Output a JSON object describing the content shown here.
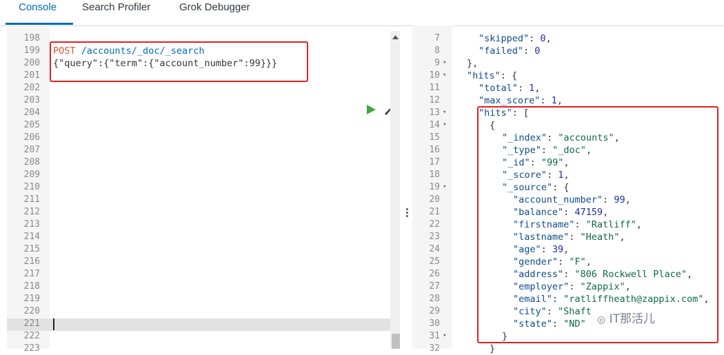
{
  "tabs": [
    "Console",
    "Search Profiler",
    "Grok Debugger"
  ],
  "left": {
    "line_numbers": [
      "198",
      "199",
      "200",
      "201",
      "202",
      "203",
      "204",
      "205",
      "206",
      "207",
      "208",
      "209",
      "210",
      "211",
      "212",
      "213",
      "214",
      "215",
      "216",
      "217",
      "218",
      "219",
      "220",
      "221",
      "222",
      "223"
    ],
    "request_method": "POST",
    "request_path": "/accounts/_doc/_search",
    "request_body": "{\"query\":{\"term\":{\"account_number\":99}}}"
  },
  "right": {
    "line_numbers": [
      "7",
      "8",
      "9",
      "10",
      "11",
      "12",
      "13",
      "14",
      "15",
      "16",
      "17",
      "18",
      "19",
      "20",
      "21",
      "22",
      "23",
      "24",
      "25",
      "26",
      "27",
      "28",
      "29",
      "30",
      "31",
      "32"
    ],
    "fold_markers": [
      "9",
      "10",
      "13",
      "14",
      "19",
      "31"
    ]
  },
  "response": {
    "skipped": "0",
    "failed": "0",
    "total": "1",
    "max_score": "1",
    "index": "\"accounts\"",
    "type": "\"_doc\"",
    "id": "\"99\"",
    "score": "1",
    "account_number": "99",
    "balance": "47159",
    "firstname": "\"Ratliff\"",
    "lastname": "\"Heath\"",
    "age": "39",
    "gender": "\"F\"",
    "address": "\"806 Rockwell Place\"",
    "employer": "\"Zappix\"",
    "email": "\"ratliffheath@zappix.com\"",
    "city": "\"Shaft",
    "state": "\"ND\""
  },
  "watermark": "IT那活儿"
}
